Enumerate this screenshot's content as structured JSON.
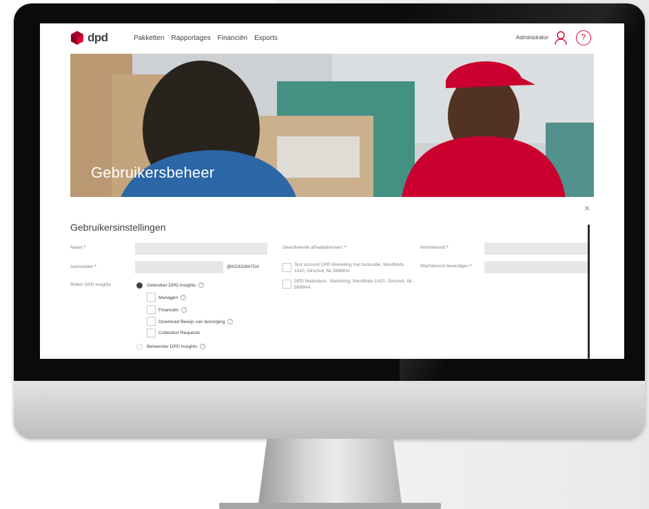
{
  "brand": {
    "name": "dpd",
    "accent": "#dc0032"
  },
  "nav": {
    "items": [
      "Pakketten",
      "Rapportages",
      "Financiën",
      "Exports"
    ],
    "account_label": "Administrator",
    "user_icon": "user-icon",
    "help_icon": "help-icon",
    "help_glyph": "?"
  },
  "hero": {
    "title": "Gebruikersbeheer"
  },
  "panel": {
    "close_glyph": "×",
    "title": "Gebruikersinstellingen",
    "naam_label": "Naam",
    "aanmelden_label": "Aanmelden",
    "aanmelden_suffix": "@KD332647DA",
    "rollen_label": "Rollen DPD Insights",
    "required_mark": "*",
    "role_user": "Gebruiker DPD Insights",
    "role_user_selected": true,
    "permissions": [
      "Managen",
      "Financiën",
      "Download Bewijs van bezorging",
      "Collection Requests"
    ],
    "permission_info": [
      true,
      true,
      true,
      false
    ],
    "role_admin": "Beheerder DPD Insights",
    "info_glyph": "?",
    "addresses_label": "Geactiveerde afhaaladressen:",
    "addresses": [
      "Test account DPD Marketing met facturatie, Westfields 1410, Oirschot, NL-5688HA",
      "DPD Nederland - Marketing, Westfields 1410, Oirschot, NL-5688HA"
    ],
    "wachtwoord_label": "Wachtwoord",
    "wachtwoord_confirm_label": "Wachtwoord bevestigen"
  }
}
